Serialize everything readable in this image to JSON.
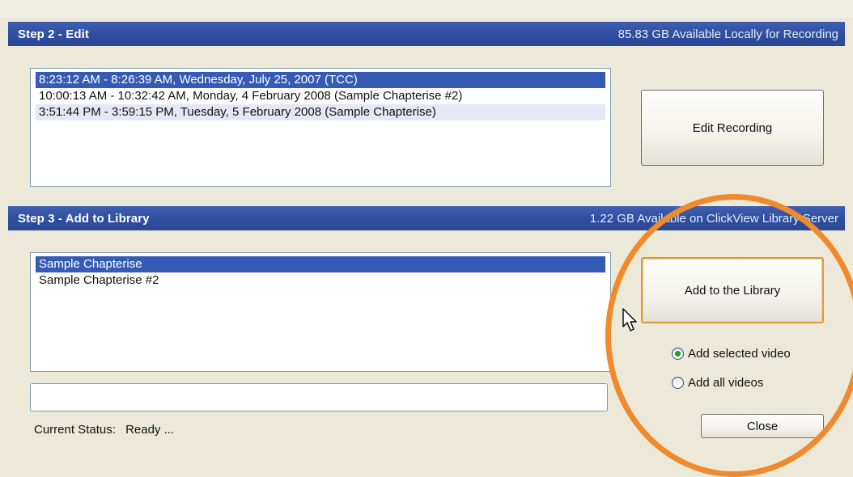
{
  "step2": {
    "title": "Step 2 - Edit",
    "info": "85.83 GB Available Locally for Recording",
    "recordings": [
      {
        "text": "8:23:12 AM - 8:26:39 AM, Wednesday, July 25, 2007 (TCC)",
        "state": "selected"
      },
      {
        "text": "10:00:13 AM - 10:32:42 AM, Monday, 4 February 2008 (Sample Chapterise #2)",
        "state": "normal"
      },
      {
        "text": "3:51:44 PM - 3:59:15 PM, Tuesday, 5 February 2008 (Sample Chapterise)",
        "state": "alt"
      }
    ],
    "edit_button": "Edit Recording"
  },
  "step3": {
    "title": "Step 3 - Add to Library",
    "info": "1.22 GB Available on ClickView Library Server",
    "videos": [
      {
        "text": "Sample Chapterise",
        "state": "selected"
      },
      {
        "text": "Sample Chapterise #2",
        "state": "normal"
      }
    ],
    "add_button": "Add to the Library",
    "radio_selected": "Add selected video",
    "radio_all": "Add all videos",
    "selected_option": "selected",
    "close_button": "Close",
    "status_label": "Current Status:",
    "status_value": "Ready ..."
  },
  "colors": {
    "header_blue": "#2f4e9f",
    "selection_blue": "#355bb4",
    "highlight_orange": "#f08a2c"
  },
  "icons": [
    "mouse-pointer-icon"
  ]
}
